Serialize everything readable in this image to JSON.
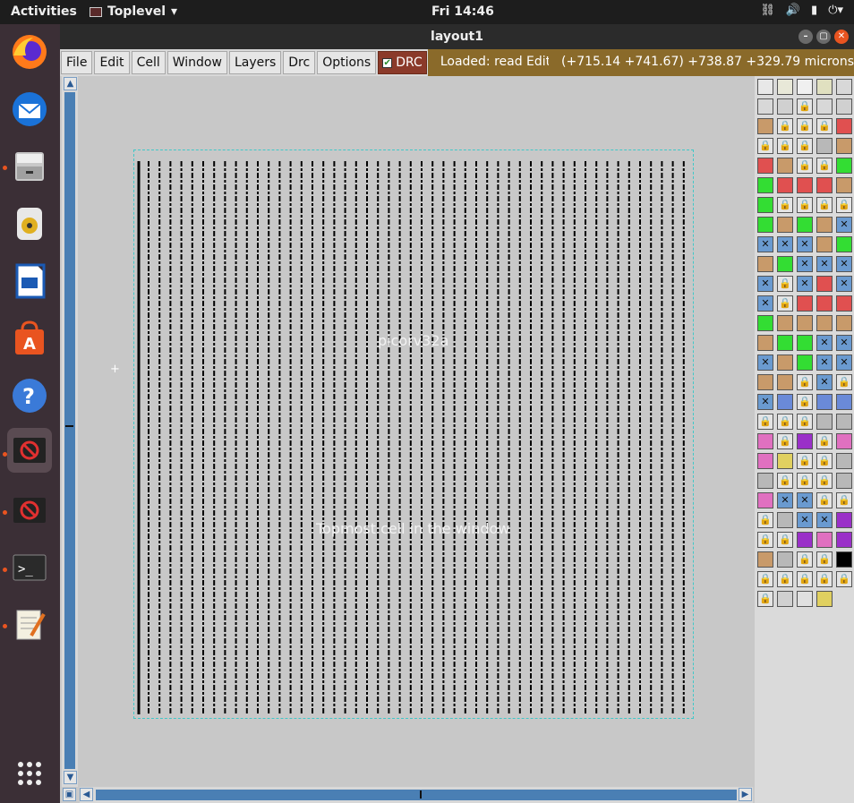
{
  "topbar": {
    "activities": "Activities",
    "app_name": "Toplevel",
    "clock": "Fri 14:46"
  },
  "window": {
    "title": "layout1"
  },
  "menu": {
    "file": "File",
    "edit": "Edit",
    "cell": "Cell",
    "window": "Window",
    "layers": "Layers",
    "drc_menu": "Drc",
    "options": "Options",
    "drc_toggle": "DRC"
  },
  "status": {
    "loaded": "Loaded: read Editing: re",
    "coords": "(+715.14 +741.67) +738.87 +329.79 microns"
  },
  "layout": {
    "cell_name": "picorv32a",
    "cell_note": "Topmost cell in the window"
  },
  "dock": {
    "apps": [
      "firefox-icon",
      "thunderbird-icon",
      "files-icon",
      "rhythmbox-icon",
      "writer-icon",
      "software-icon",
      "help-icon",
      "magic-icon",
      "magic-icon",
      "terminal-icon",
      "text-editor-icon"
    ]
  },
  "palette": {
    "colors": {
      "green": "#33dd33",
      "tan": "#c89a6a",
      "red": "#e05050",
      "blue": "#6a8ad8",
      "pink": "#e070c0",
      "purple": "#9a30c8",
      "gray": "#b8b8b8",
      "yellow": "#e0d060"
    }
  }
}
